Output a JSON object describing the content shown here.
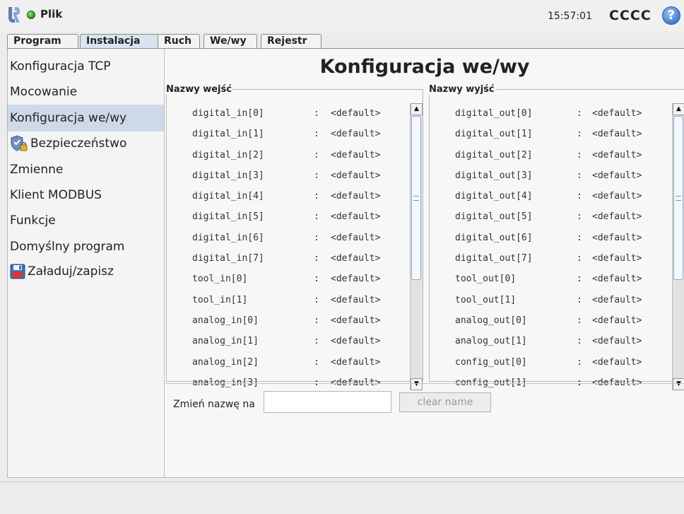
{
  "topbar": {
    "file_menu": "Plik",
    "clock": "15:57:01",
    "robot_name": "CCCC",
    "help": "?"
  },
  "tabs": [
    {
      "label": "Program",
      "active": false
    },
    {
      "label": "Instalacja",
      "active": true
    },
    {
      "label": "Ruch",
      "active": false
    },
    {
      "label": "We/wy",
      "active": false
    },
    {
      "label": "Rejestr",
      "active": false
    }
  ],
  "sidebar": {
    "items": [
      {
        "label": "Konfiguracja TCP"
      },
      {
        "label": "Mocowanie"
      },
      {
        "label": "Konfiguracja we/wy",
        "active": true
      },
      {
        "label": "Bezpieczeństwo",
        "icon": "shield-lock-icon"
      },
      {
        "label": "Zmienne"
      },
      {
        "label": "Klient MODBUS"
      },
      {
        "label": "Funkcje"
      },
      {
        "label": "Domyślny program"
      },
      {
        "label": "Załaduj/zapisz",
        "icon": "save-disk-icon"
      }
    ]
  },
  "main": {
    "title": "Konfiguracja we/wy",
    "inputs": {
      "legend": "Nazwy wejść",
      "rows": [
        {
          "name": "digital_in[0]",
          "sep": ":",
          "value": "<default>"
        },
        {
          "name": "digital_in[1]",
          "sep": ":",
          "value": "<default>"
        },
        {
          "name": "digital_in[2]",
          "sep": ":",
          "value": "<default>"
        },
        {
          "name": "digital_in[3]",
          "sep": ":",
          "value": "<default>"
        },
        {
          "name": "digital_in[4]",
          "sep": ":",
          "value": "<default>"
        },
        {
          "name": "digital_in[5]",
          "sep": ":",
          "value": "<default>"
        },
        {
          "name": "digital_in[6]",
          "sep": ":",
          "value": "<default>"
        },
        {
          "name": "digital_in[7]",
          "sep": ":",
          "value": "<default>"
        },
        {
          "name": "tool_in[0]",
          "sep": ":",
          "value": "<default>"
        },
        {
          "name": "tool_in[1]",
          "sep": ":",
          "value": "<default>"
        },
        {
          "name": "analog_in[0]",
          "sep": ":",
          "value": "<default>"
        },
        {
          "name": "analog_in[1]",
          "sep": ":",
          "value": "<default>"
        },
        {
          "name": "analog_in[2]",
          "sep": ":",
          "value": "<default>"
        },
        {
          "name": "analog_in[3]",
          "sep": ":",
          "value": "<default>"
        }
      ]
    },
    "outputs": {
      "legend": "Nazwy wyjść",
      "rows": [
        {
          "name": "digital_out[0]",
          "sep": ":",
          "value": "<default>"
        },
        {
          "name": "digital_out[1]",
          "sep": ":",
          "value": "<default>"
        },
        {
          "name": "digital_out[2]",
          "sep": ":",
          "value": "<default>"
        },
        {
          "name": "digital_out[3]",
          "sep": ":",
          "value": "<default>"
        },
        {
          "name": "digital_out[4]",
          "sep": ":",
          "value": "<default>"
        },
        {
          "name": "digital_out[5]",
          "sep": ":",
          "value": "<default>"
        },
        {
          "name": "digital_out[6]",
          "sep": ":",
          "value": "<default>"
        },
        {
          "name": "digital_out[7]",
          "sep": ":",
          "value": "<default>"
        },
        {
          "name": "tool_out[0]",
          "sep": ":",
          "value": "<default>"
        },
        {
          "name": "tool_out[1]",
          "sep": ":",
          "value": "<default>"
        },
        {
          "name": "analog_out[0]",
          "sep": ":",
          "value": "<default>"
        },
        {
          "name": "analog_out[1]",
          "sep": ":",
          "value": "<default>"
        },
        {
          "name": "config_out[0]",
          "sep": ":",
          "value": "<default>"
        },
        {
          "name": "config_out[1]",
          "sep": ":",
          "value": "<default>"
        }
      ]
    },
    "rename": {
      "label": "Zmień nazwę na",
      "value": "",
      "clear_label": "clear name"
    }
  },
  "colors": {
    "active_tab": "#d9e4f0",
    "active_sidebar": "#cdd9e8",
    "status_ok": "#2f8f19",
    "help": "#3a78c8"
  }
}
